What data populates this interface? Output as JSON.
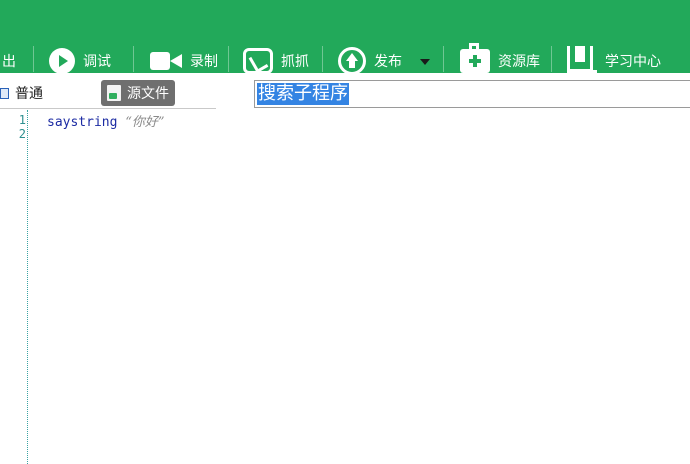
{
  "colors": {
    "toolbar_bg": "#22a95a",
    "source_tab_bg": "#6f6f6f",
    "selection_bg": "#3484e3",
    "keyword": "#1c2ba3",
    "string": "#8a8a8a"
  },
  "toolbar": {
    "items": [
      {
        "label": "出",
        "icon": "export-icon"
      },
      {
        "label": "调试",
        "icon": "play-icon"
      },
      {
        "label": "录制",
        "icon": "camera-icon"
      },
      {
        "label": "抓抓",
        "icon": "grab-icon"
      },
      {
        "label": "发布",
        "icon": "publish-icon"
      },
      {
        "label": "资源库",
        "icon": "resource-library-icon"
      },
      {
        "label": "学习中心",
        "icon": "learning-center-icon"
      }
    ]
  },
  "tabs": {
    "normal": {
      "label": "普通",
      "icon": "normal-view-icon"
    },
    "source": {
      "label": "源文件",
      "icon": "source-file-icon",
      "active": true
    }
  },
  "search": {
    "value": "搜索子程序"
  },
  "editor": {
    "lines": [
      {
        "number": "1",
        "keyword": "saystring",
        "string": "“你好”"
      },
      {
        "number": "2",
        "keyword": "",
        "string": ""
      }
    ]
  }
}
